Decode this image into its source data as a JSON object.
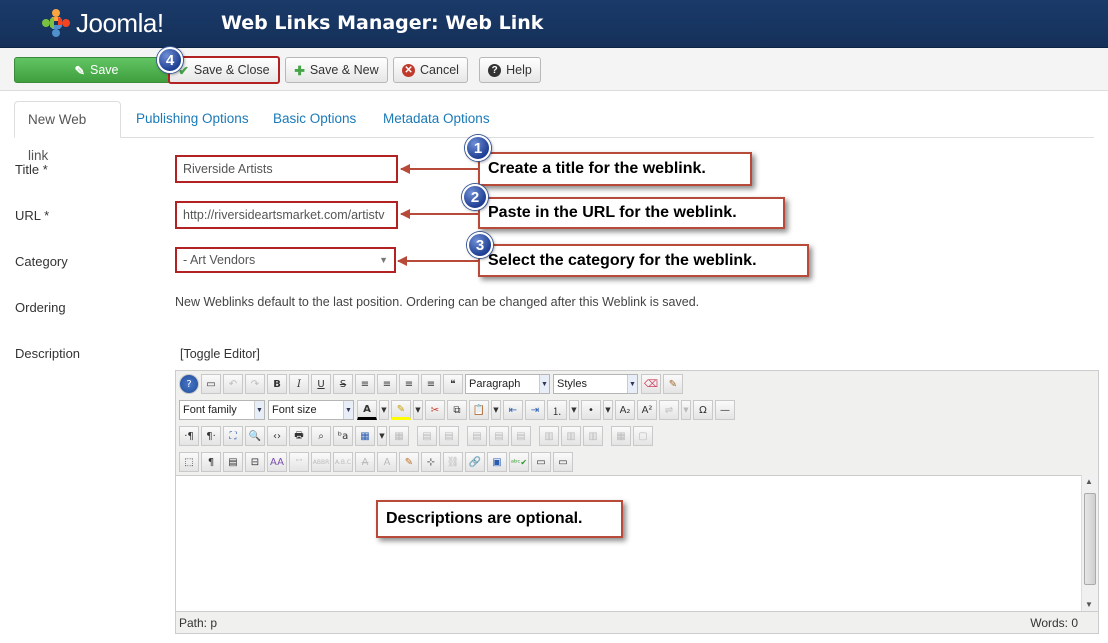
{
  "header": {
    "logo_text": "Joomla!",
    "title": "Web Links Manager: Web Link"
  },
  "toolbar": {
    "save": "Save",
    "save_close": "Save & Close",
    "save_new": "Save & New",
    "cancel": "Cancel",
    "help": "Help"
  },
  "badges": [
    "1",
    "2",
    "3",
    "4"
  ],
  "tabs": [
    "New Web link",
    "Publishing Options",
    "Basic Options",
    "Metadata Options"
  ],
  "form": {
    "title_label": "Title *",
    "title_value": "Riverside Artists",
    "url_label": "URL *",
    "url_value": "http://riversideartsmarket.com/artistv",
    "category_label": "Category",
    "category_value": "- Art Vendors",
    "ordering_label": "Ordering",
    "ordering_text": "New Weblinks default to the last position. Ordering can be changed after this Weblink is saved.",
    "description_label": "Description"
  },
  "callouts": {
    "title": "Create a title for the weblink.",
    "url": "Paste in the URL for the weblink.",
    "category": "Select the category for the weblink.",
    "description": "Descriptions are optional."
  },
  "editor": {
    "toggle": "[Toggle Editor]",
    "format_select": "Paragraph",
    "styles_select": "Styles",
    "font_family_select": "Font family",
    "font_size_select": "Font size",
    "path": "Path:  p",
    "words": "Words: 0"
  },
  "colors": {
    "header_bg": "#1b3a69",
    "save_green": "#4cae4c",
    "highlight_red": "#b22222",
    "link_blue": "#1a7ab8"
  }
}
